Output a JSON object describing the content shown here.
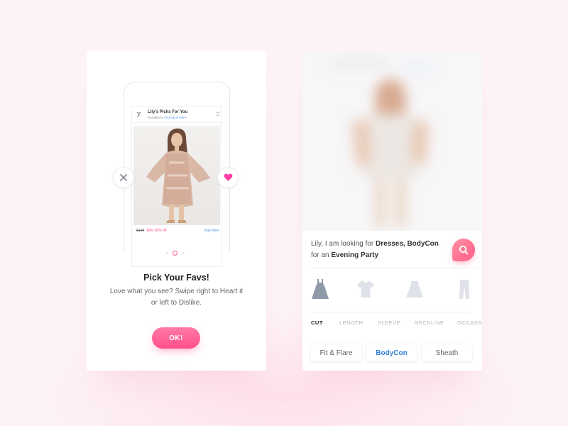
{
  "colors": {
    "accent": "#ff5a8a",
    "link": "#4a90e2",
    "selected_chip": "#2f80d9"
  },
  "onboarding": {
    "app": {
      "logo": "y",
      "title": "Lily's Picks For You",
      "store": "Nordstrom,",
      "pickup": "Pick up in store",
      "price_old": "$138",
      "price_new": "$48, 60% off",
      "buy_label": "Buy Now"
    },
    "dislike_icon": "close-icon",
    "like_icon": "heart-icon",
    "pagination": {
      "count": 3,
      "active": 1
    },
    "title": "Pick Your Favs!",
    "description": "Love what you see? Swipe right to Heart it or left to Dislike.",
    "ok_label": "OK!"
  },
  "search": {
    "query_prefix": "Lily, I am looking for",
    "query_bold_1": "Dresses, BodyCon",
    "query_middle": "for an",
    "query_bold_2": "Evening Party",
    "search_icon": "search-icon",
    "garments": [
      {
        "name": "dress-icon",
        "selected": true
      },
      {
        "name": "top-icon",
        "selected": false
      },
      {
        "name": "skirt-icon",
        "selected": false
      },
      {
        "name": "pants-icon",
        "selected": false
      }
    ],
    "tabs": [
      {
        "label": "CUT",
        "active": true
      },
      {
        "label": "LENGTH",
        "active": false
      },
      {
        "label": "SLEEVE",
        "active": false
      },
      {
        "label": "NECKLINE",
        "active": false
      },
      {
        "label": "OCCASSION",
        "active": false
      }
    ],
    "chips": [
      {
        "label": "Fit & Flare",
        "selected": false
      },
      {
        "label": "BodyCon",
        "selected": true
      },
      {
        "label": "Sheath",
        "selected": false
      }
    ]
  }
}
